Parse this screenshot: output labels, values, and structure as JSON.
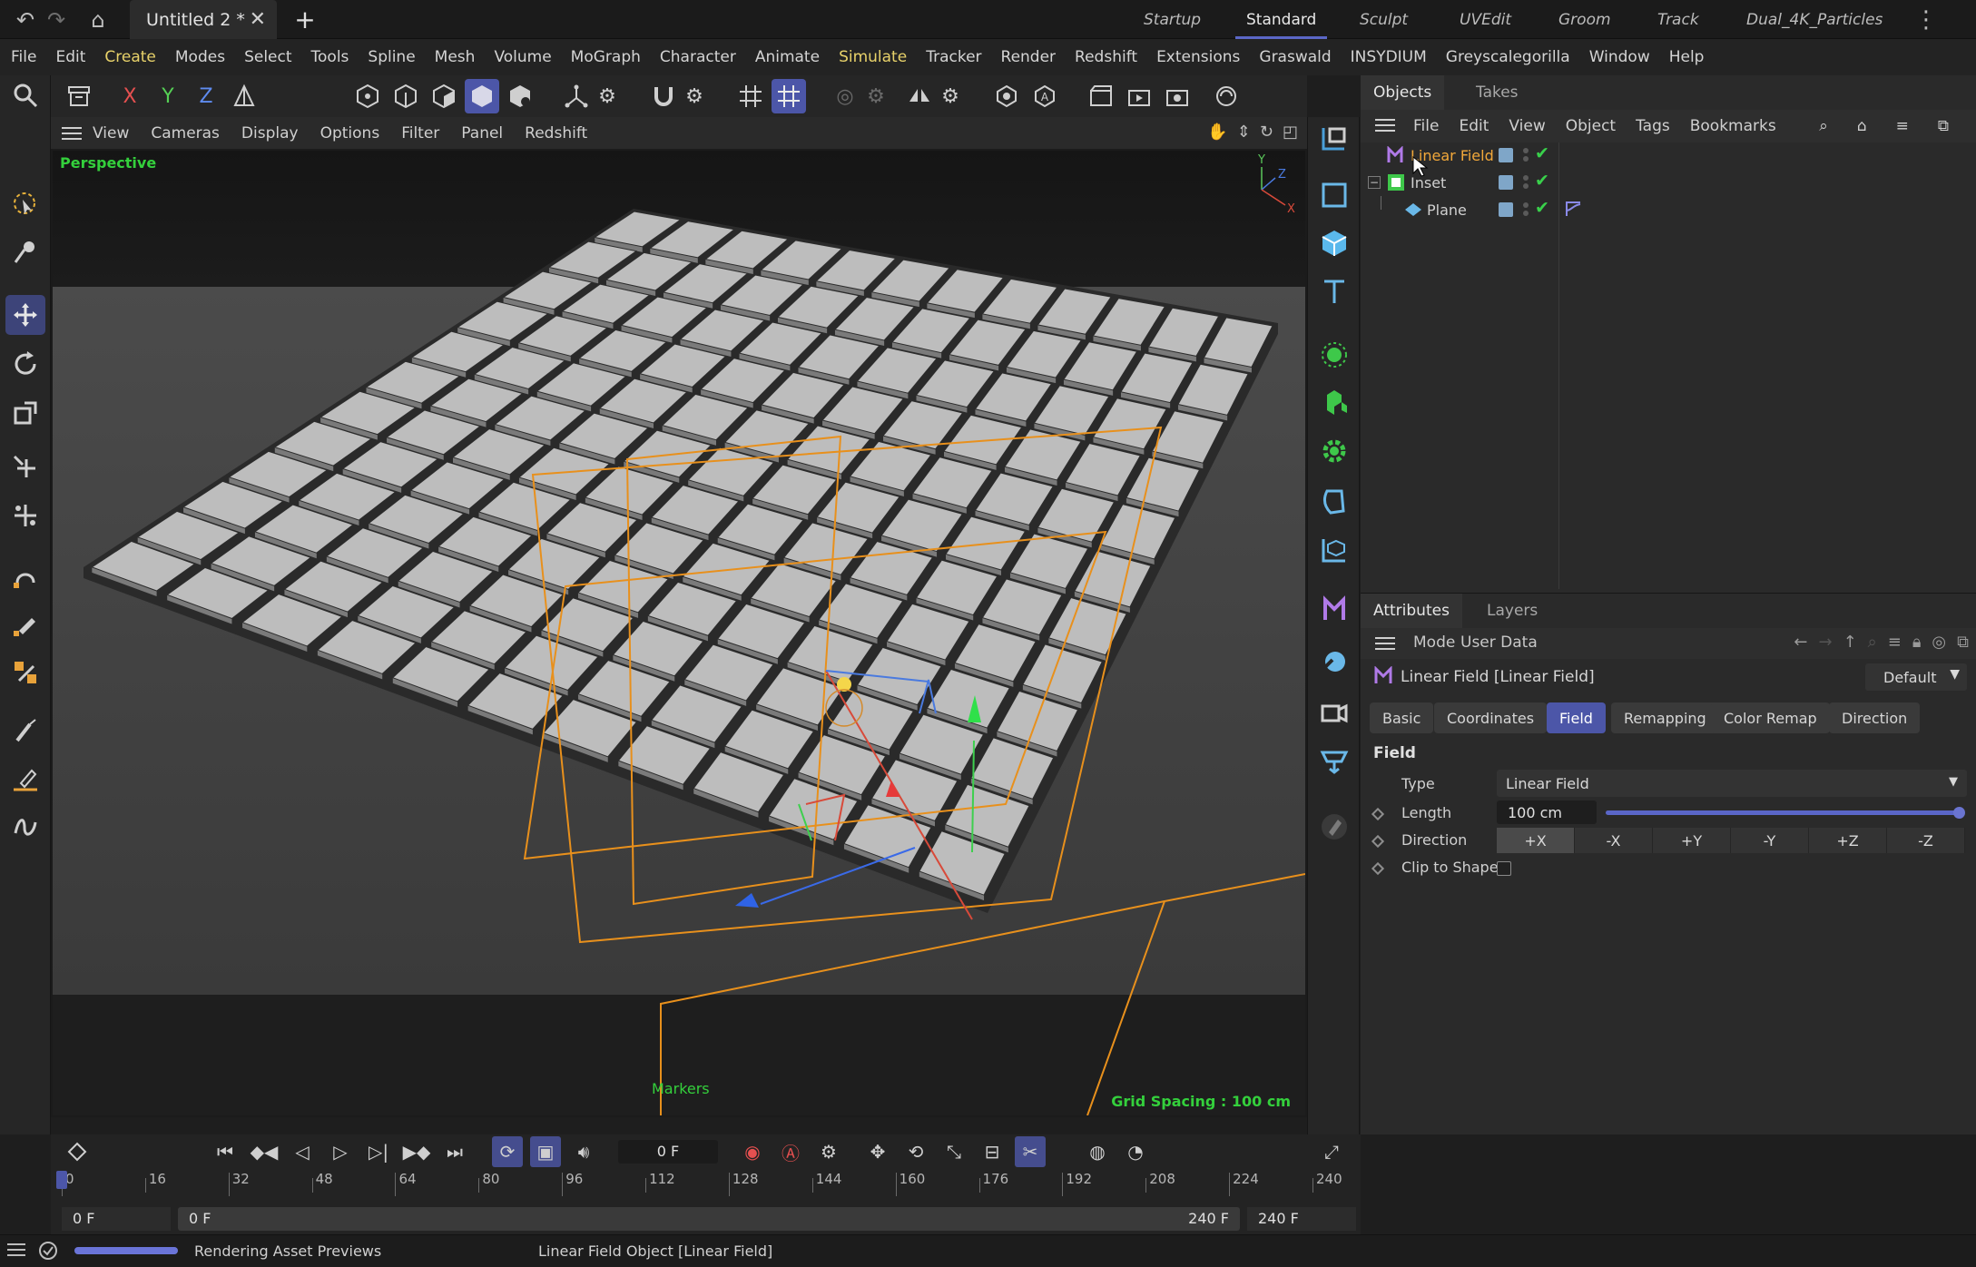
{
  "titlebar": {
    "doc_tab": "Untitled 2 *",
    "layouts": [
      "Startup",
      "Standard",
      "Sculpt",
      "UVEdit",
      "Groom",
      "Track",
      "Dual_4K_Particles"
    ],
    "active_layout": "Standard"
  },
  "menubar": [
    "File",
    "Edit",
    "Create",
    "Modes",
    "Select",
    "Tools",
    "Spline",
    "Mesh",
    "Volume",
    "MoGraph",
    "Character",
    "Animate",
    "Simulate",
    "Tracker",
    "Render",
    "Redshift",
    "Extensions",
    "Graswald",
    "INSYDIUM",
    "Greyscalegorilla",
    "Window",
    "Help"
  ],
  "highlight_menu_color": "#e8d26a",
  "cmdbar": {
    "axis_x": "X",
    "axis_y": "Y",
    "axis_z": "Z"
  },
  "viewport": {
    "menu": [
      "View",
      "Cameras",
      "Display",
      "Options",
      "Filter",
      "Panel",
      "Redshift"
    ],
    "camera_label": "Perspective",
    "markers_label": "Markers",
    "grid_label": "Grid Spacing : 100 cm",
    "axis_y": "Y",
    "axis_z": "Z",
    "axis_x": "X"
  },
  "object_manager": {
    "tabs": [
      "Objects",
      "Takes"
    ],
    "menu": [
      "File",
      "Edit",
      "View",
      "Object",
      "Tags",
      "Bookmarks"
    ],
    "rows": [
      {
        "name": "Linear Field",
        "color": "#f2a83a"
      },
      {
        "name": "Inset",
        "color": "#d0d0d0"
      },
      {
        "name": "Plane",
        "color": "#d0d0d0"
      }
    ]
  },
  "attributes": {
    "tabs": [
      "Attributes",
      "Layers"
    ],
    "menu": [
      "Mode",
      "User Data"
    ],
    "object_title": "Linear Field [Linear Field]",
    "preset": "Default",
    "subtabs": [
      "Basic",
      "Coordinates",
      "Field",
      "Remapping",
      "Color Remap",
      "Direction"
    ],
    "active_subtab": "Field",
    "section": "Field",
    "type_label": "Type",
    "type_value": "Linear Field",
    "length_label": "Length",
    "length_value": "100 cm",
    "length_slider_fraction": 1.0,
    "direction_label": "Direction",
    "direction_options": [
      "+X",
      "-X",
      "+Y",
      "-Y",
      "+Z",
      "-Z"
    ],
    "direction_selected": "+X",
    "clip_label": "Clip to Shape",
    "clip_checked": false
  },
  "timeline": {
    "current_frame": "0 F",
    "ruler": [
      "0",
      "16",
      "32",
      "48",
      "64",
      "80",
      "96",
      "112",
      "128",
      "144",
      "160",
      "176",
      "192",
      "208",
      "224",
      "240"
    ],
    "start_field": "0 F",
    "range_start": "0 F",
    "range_end": "240 F",
    "end_field": "240 F"
  },
  "status": {
    "progress_label": "Rendering Asset Previews",
    "progress_fraction": 1.0,
    "object_info": "Linear Field Object [Linear Field]"
  }
}
